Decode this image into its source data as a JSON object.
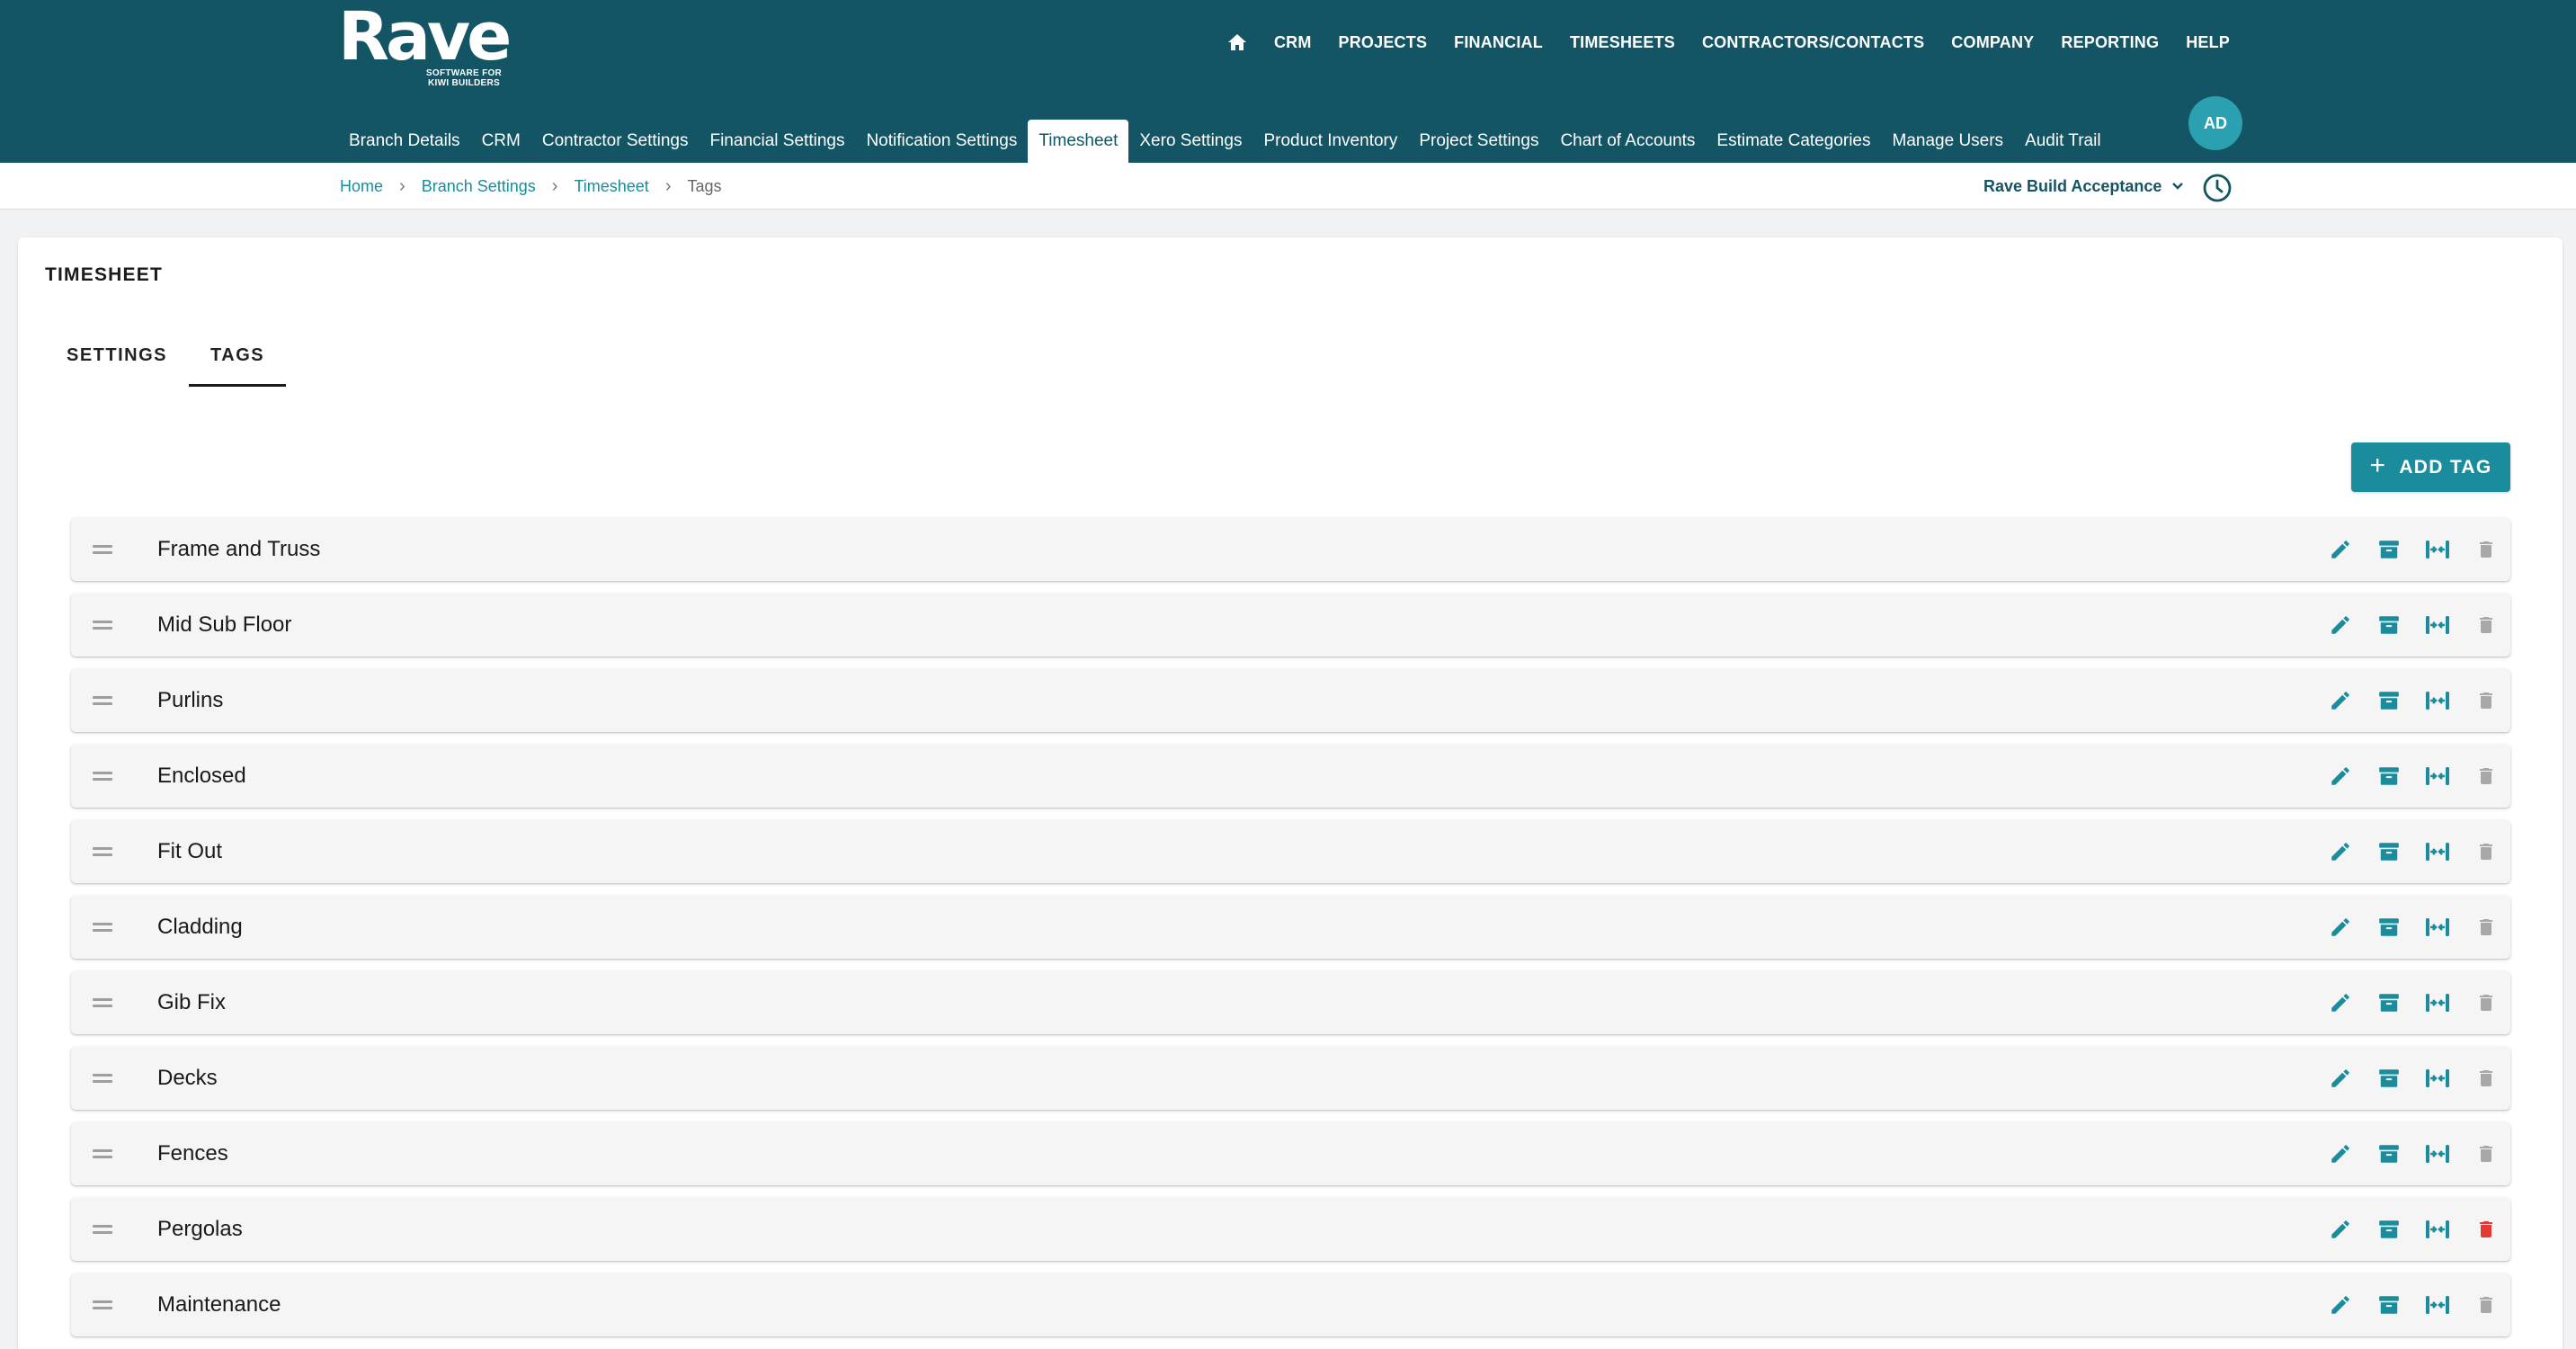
{
  "brand": {
    "name": "Rave",
    "tagline": "SOFTWARE FOR KIWI BUILDERS",
    "accent_color": "#135564",
    "button_color": "#1a8c9c",
    "danger_color": "#e53935"
  },
  "top_nav": {
    "home_icon": "home-icon",
    "items": [
      "CRM",
      "PROJECTS",
      "FINANCIAL",
      "TIMESHEETS",
      "CONTRACTORS/CONTACTS",
      "COMPANY",
      "REPORTING",
      "HELP"
    ]
  },
  "sub_nav": {
    "active": "Timesheet",
    "items": [
      "Branch Details",
      "CRM",
      "Contractor Settings",
      "Financial Settings",
      "Notification Settings",
      "Timesheet",
      "Xero Settings",
      "Product Inventory",
      "Project Settings",
      "Chart of Accounts",
      "Estimate Categories",
      "Manage Users",
      "Audit Trail"
    ]
  },
  "user": {
    "initials": "AD"
  },
  "breadcrumb": {
    "items": [
      "Home",
      "Branch Settings",
      "Timesheet"
    ],
    "current": "Tags"
  },
  "branch_select": {
    "value": "Rave Build Acceptance",
    "icon": "chevron-down-icon"
  },
  "history_icon": "clock-icon",
  "page": {
    "title": "TIMESHEET",
    "tabs": [
      {
        "label": "SETTINGS",
        "active": false
      },
      {
        "label": "TAGS",
        "active": true
      }
    ],
    "add_button": {
      "label": "ADD TAG",
      "icon": "plus-icon"
    }
  },
  "tags": [
    {
      "name": "Frame and Truss",
      "delete_highlight": false
    },
    {
      "name": "Mid Sub Floor",
      "delete_highlight": false
    },
    {
      "name": "Purlins",
      "delete_highlight": false
    },
    {
      "name": "Enclosed",
      "delete_highlight": false
    },
    {
      "name": "Fit Out",
      "delete_highlight": false
    },
    {
      "name": "Cladding",
      "delete_highlight": false
    },
    {
      "name": "Gib Fix",
      "delete_highlight": false
    },
    {
      "name": "Decks",
      "delete_highlight": false
    },
    {
      "name": "Fences",
      "delete_highlight": false
    },
    {
      "name": "Pergolas",
      "delete_highlight": true
    },
    {
      "name": "Maintenance",
      "delete_highlight": false
    }
  ],
  "row_actions": [
    "edit-icon",
    "archive-icon",
    "merge-icon",
    "delete-icon"
  ]
}
